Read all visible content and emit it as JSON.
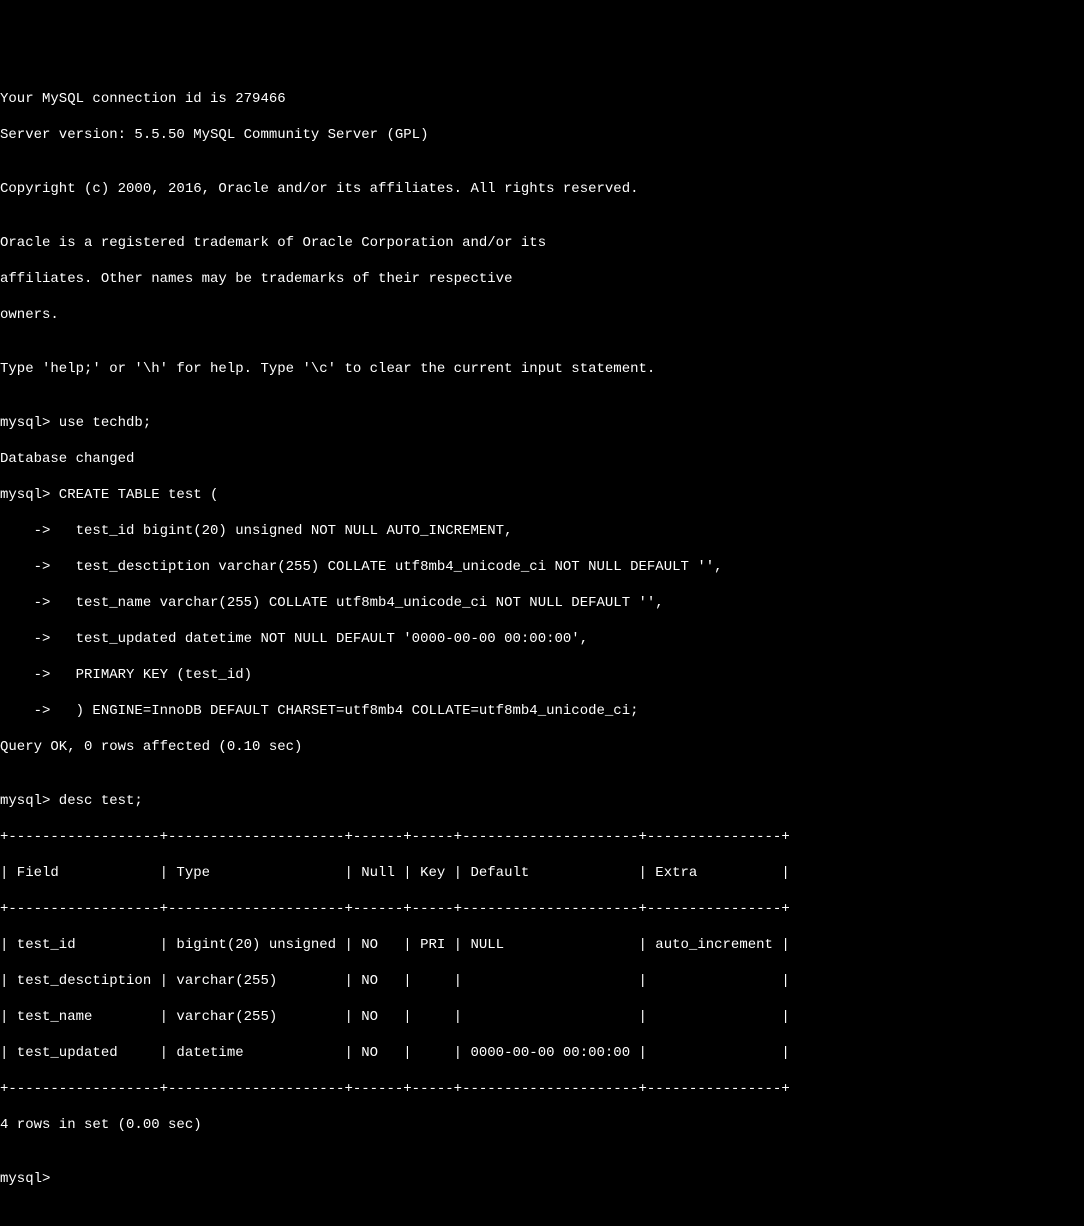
{
  "lines": {
    "l0": "Your MySQL connection id is 279466",
    "l1": "Server version: 5.5.50 MySQL Community Server (GPL)",
    "l2": "",
    "l3": "Copyright (c) 2000, 2016, Oracle and/or its affiliates. All rights reserved.",
    "l4": "",
    "l5": "Oracle is a registered trademark of Oracle Corporation and/or its",
    "l6": "affiliates. Other names may be trademarks of their respective",
    "l7": "owners.",
    "l8": "",
    "l9": "Type 'help;' or '\\h' for help. Type '\\c' to clear the current input statement.",
    "l10": "",
    "l11": "mysql> use techdb;",
    "l12": "Database changed",
    "l13": "mysql> CREATE TABLE test (",
    "l14": "    ->   test_id bigint(20) unsigned NOT NULL AUTO_INCREMENT,",
    "l15": "    ->   test_desctiption varchar(255) COLLATE utf8mb4_unicode_ci NOT NULL DEFAULT '',",
    "l16": "    ->   test_name varchar(255) COLLATE utf8mb4_unicode_ci NOT NULL DEFAULT '',",
    "l17": "    ->   test_updated datetime NOT NULL DEFAULT '0000-00-00 00:00:00',",
    "l18": "    ->   PRIMARY KEY (test_id)",
    "l19": "    ->   ) ENGINE=InnoDB DEFAULT CHARSET=utf8mb4 COLLATE=utf8mb4_unicode_ci;",
    "l20": "Query OK, 0 rows affected (0.10 sec)",
    "l21": "",
    "l22": "mysql> desc test;",
    "l23": "+------------------+---------------------+------+-----+---------------------+----------------+",
    "l24": "| Field            | Type                | Null | Key | Default             | Extra          |",
    "l25": "+------------------+---------------------+------+-----+---------------------+----------------+",
    "l26": "| test_id          | bigint(20) unsigned | NO   | PRI | NULL                | auto_increment |",
    "l27": "| test_desctiption | varchar(255)        | NO   |     |                     |                |",
    "l28": "| test_name        | varchar(255)        | NO   |     |                     |                |",
    "l29": "| test_updated     | datetime            | NO   |     | 0000-00-00 00:00:00 |                |",
    "l30": "+------------------+---------------------+------+-----+---------------------+----------------+",
    "l31": "4 rows in set (0.00 sec)",
    "l32": "",
    "l33": "mysql> "
  }
}
